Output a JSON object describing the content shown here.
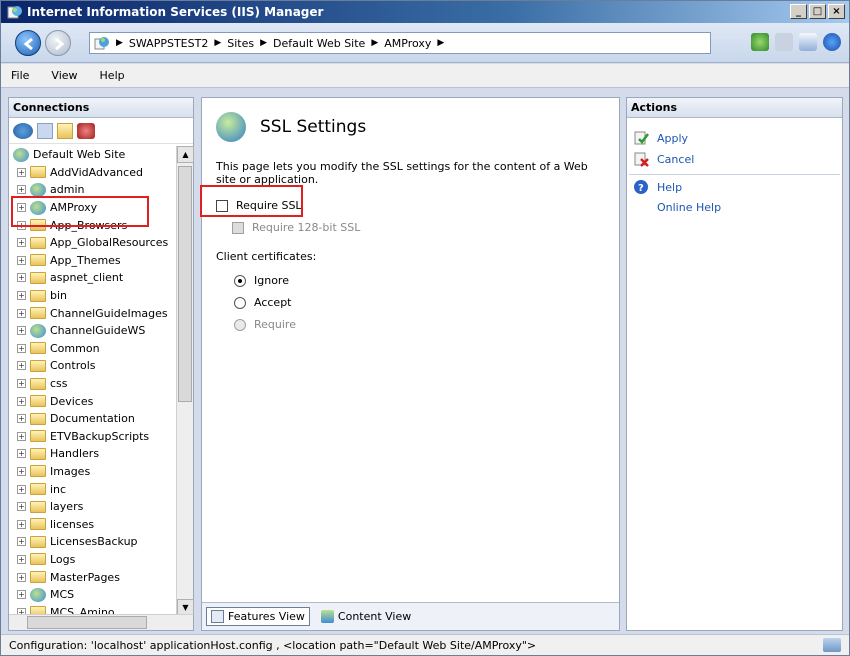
{
  "window": {
    "title": "Internet Information Services (IIS) Manager",
    "minimize": "_",
    "maximize": "□",
    "close": "×"
  },
  "address": {
    "crumbs": [
      "SWAPPSTEST2",
      "Sites",
      "Default Web Site",
      "AMProxy"
    ],
    "separator": "▶"
  },
  "menu": [
    "File",
    "View",
    "Help"
  ],
  "connections": {
    "title": "Connections",
    "root": "Default Web Site",
    "items": [
      {
        "label": "AddVidAdvanced",
        "type": "folder"
      },
      {
        "label": "admin",
        "type": "app"
      },
      {
        "label": "AMProxy",
        "type": "app"
      },
      {
        "label": "App_Browsers",
        "type": "folder"
      },
      {
        "label": "App_GlobalResources",
        "type": "folder"
      },
      {
        "label": "App_Themes",
        "type": "folder"
      },
      {
        "label": "aspnet_client",
        "type": "folder"
      },
      {
        "label": "bin",
        "type": "folder"
      },
      {
        "label": "ChannelGuideImages",
        "type": "folder"
      },
      {
        "label": "ChannelGuideWS",
        "type": "app"
      },
      {
        "label": "Common",
        "type": "folder"
      },
      {
        "label": "Controls",
        "type": "folder"
      },
      {
        "label": "css",
        "type": "folder"
      },
      {
        "label": "Devices",
        "type": "folder"
      },
      {
        "label": "Documentation",
        "type": "folder"
      },
      {
        "label": "ETVBackupScripts",
        "type": "folder"
      },
      {
        "label": "Handlers",
        "type": "folder"
      },
      {
        "label": "Images",
        "type": "folder"
      },
      {
        "label": "inc",
        "type": "folder"
      },
      {
        "label": "layers",
        "type": "folder"
      },
      {
        "label": "licenses",
        "type": "folder"
      },
      {
        "label": "LicensesBackup",
        "type": "folder"
      },
      {
        "label": "Logs",
        "type": "folder"
      },
      {
        "label": "MasterPages",
        "type": "folder"
      },
      {
        "label": "MCS",
        "type": "app"
      },
      {
        "label": "MCS_Amino",
        "type": "folder"
      }
    ]
  },
  "main": {
    "title": "SSL Settings",
    "description": "This page lets you modify the SSL settings for the content of a Web site or application.",
    "require_ssl": "Require SSL",
    "require_128": "Require 128-bit SSL",
    "client_cert_label": "Client certificates:",
    "radio_ignore": "Ignore",
    "radio_accept": "Accept",
    "radio_require": "Require",
    "tab_features": "Features View",
    "tab_content": "Content View"
  },
  "actions": {
    "title": "Actions",
    "apply": "Apply",
    "cancel": "Cancel",
    "help": "Help",
    "online_help": "Online Help"
  },
  "status": {
    "text": "Configuration: 'localhost' applicationHost.config , <location path=\"Default Web Site/AMProxy\">"
  }
}
